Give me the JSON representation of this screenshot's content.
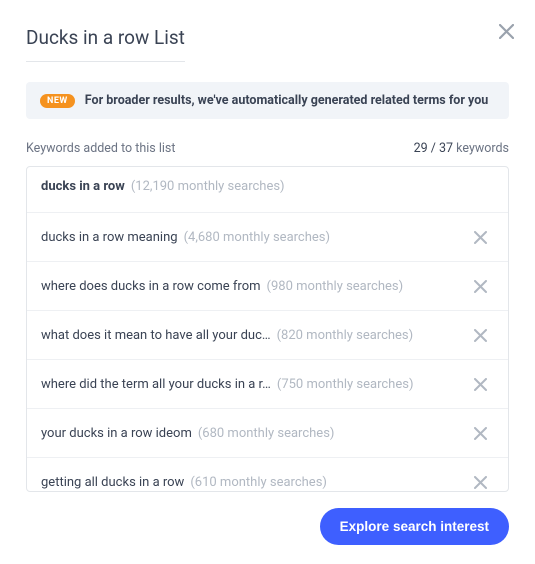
{
  "title": "Ducks in a row List",
  "banner": {
    "badge": "NEW",
    "text": "For broader results, we've automatically generated related terms for you"
  },
  "header": {
    "left": "Keywords added to this list",
    "count": "29 / 37",
    "suffix": " keywords"
  },
  "button": "Explore search interest",
  "items": [
    {
      "kw": "ducks in a row",
      "searches": "(12,190 monthly searches)",
      "bold": true,
      "removable": false
    },
    {
      "kw": "ducks in a row meaning",
      "searches": "(4,680 monthly searches)",
      "bold": false,
      "removable": true
    },
    {
      "kw": "where does ducks in a row come from",
      "searches": "(980 monthly searches)",
      "bold": false,
      "removable": true
    },
    {
      "kw": "what does it mean to have all your duc…",
      "searches": "(820 monthly searches)",
      "bold": false,
      "removable": true
    },
    {
      "kw": "where did the term all your ducks in a r…",
      "searches": "(750 monthly searches)",
      "bold": false,
      "removable": true
    },
    {
      "kw": "your ducks in a row ideom",
      "searches": "(680 monthly searches)",
      "bold": false,
      "removable": true
    },
    {
      "kw": "getting all ducks in a row",
      "searches": "(610 monthly searches)",
      "bold": false,
      "removable": true
    }
  ]
}
